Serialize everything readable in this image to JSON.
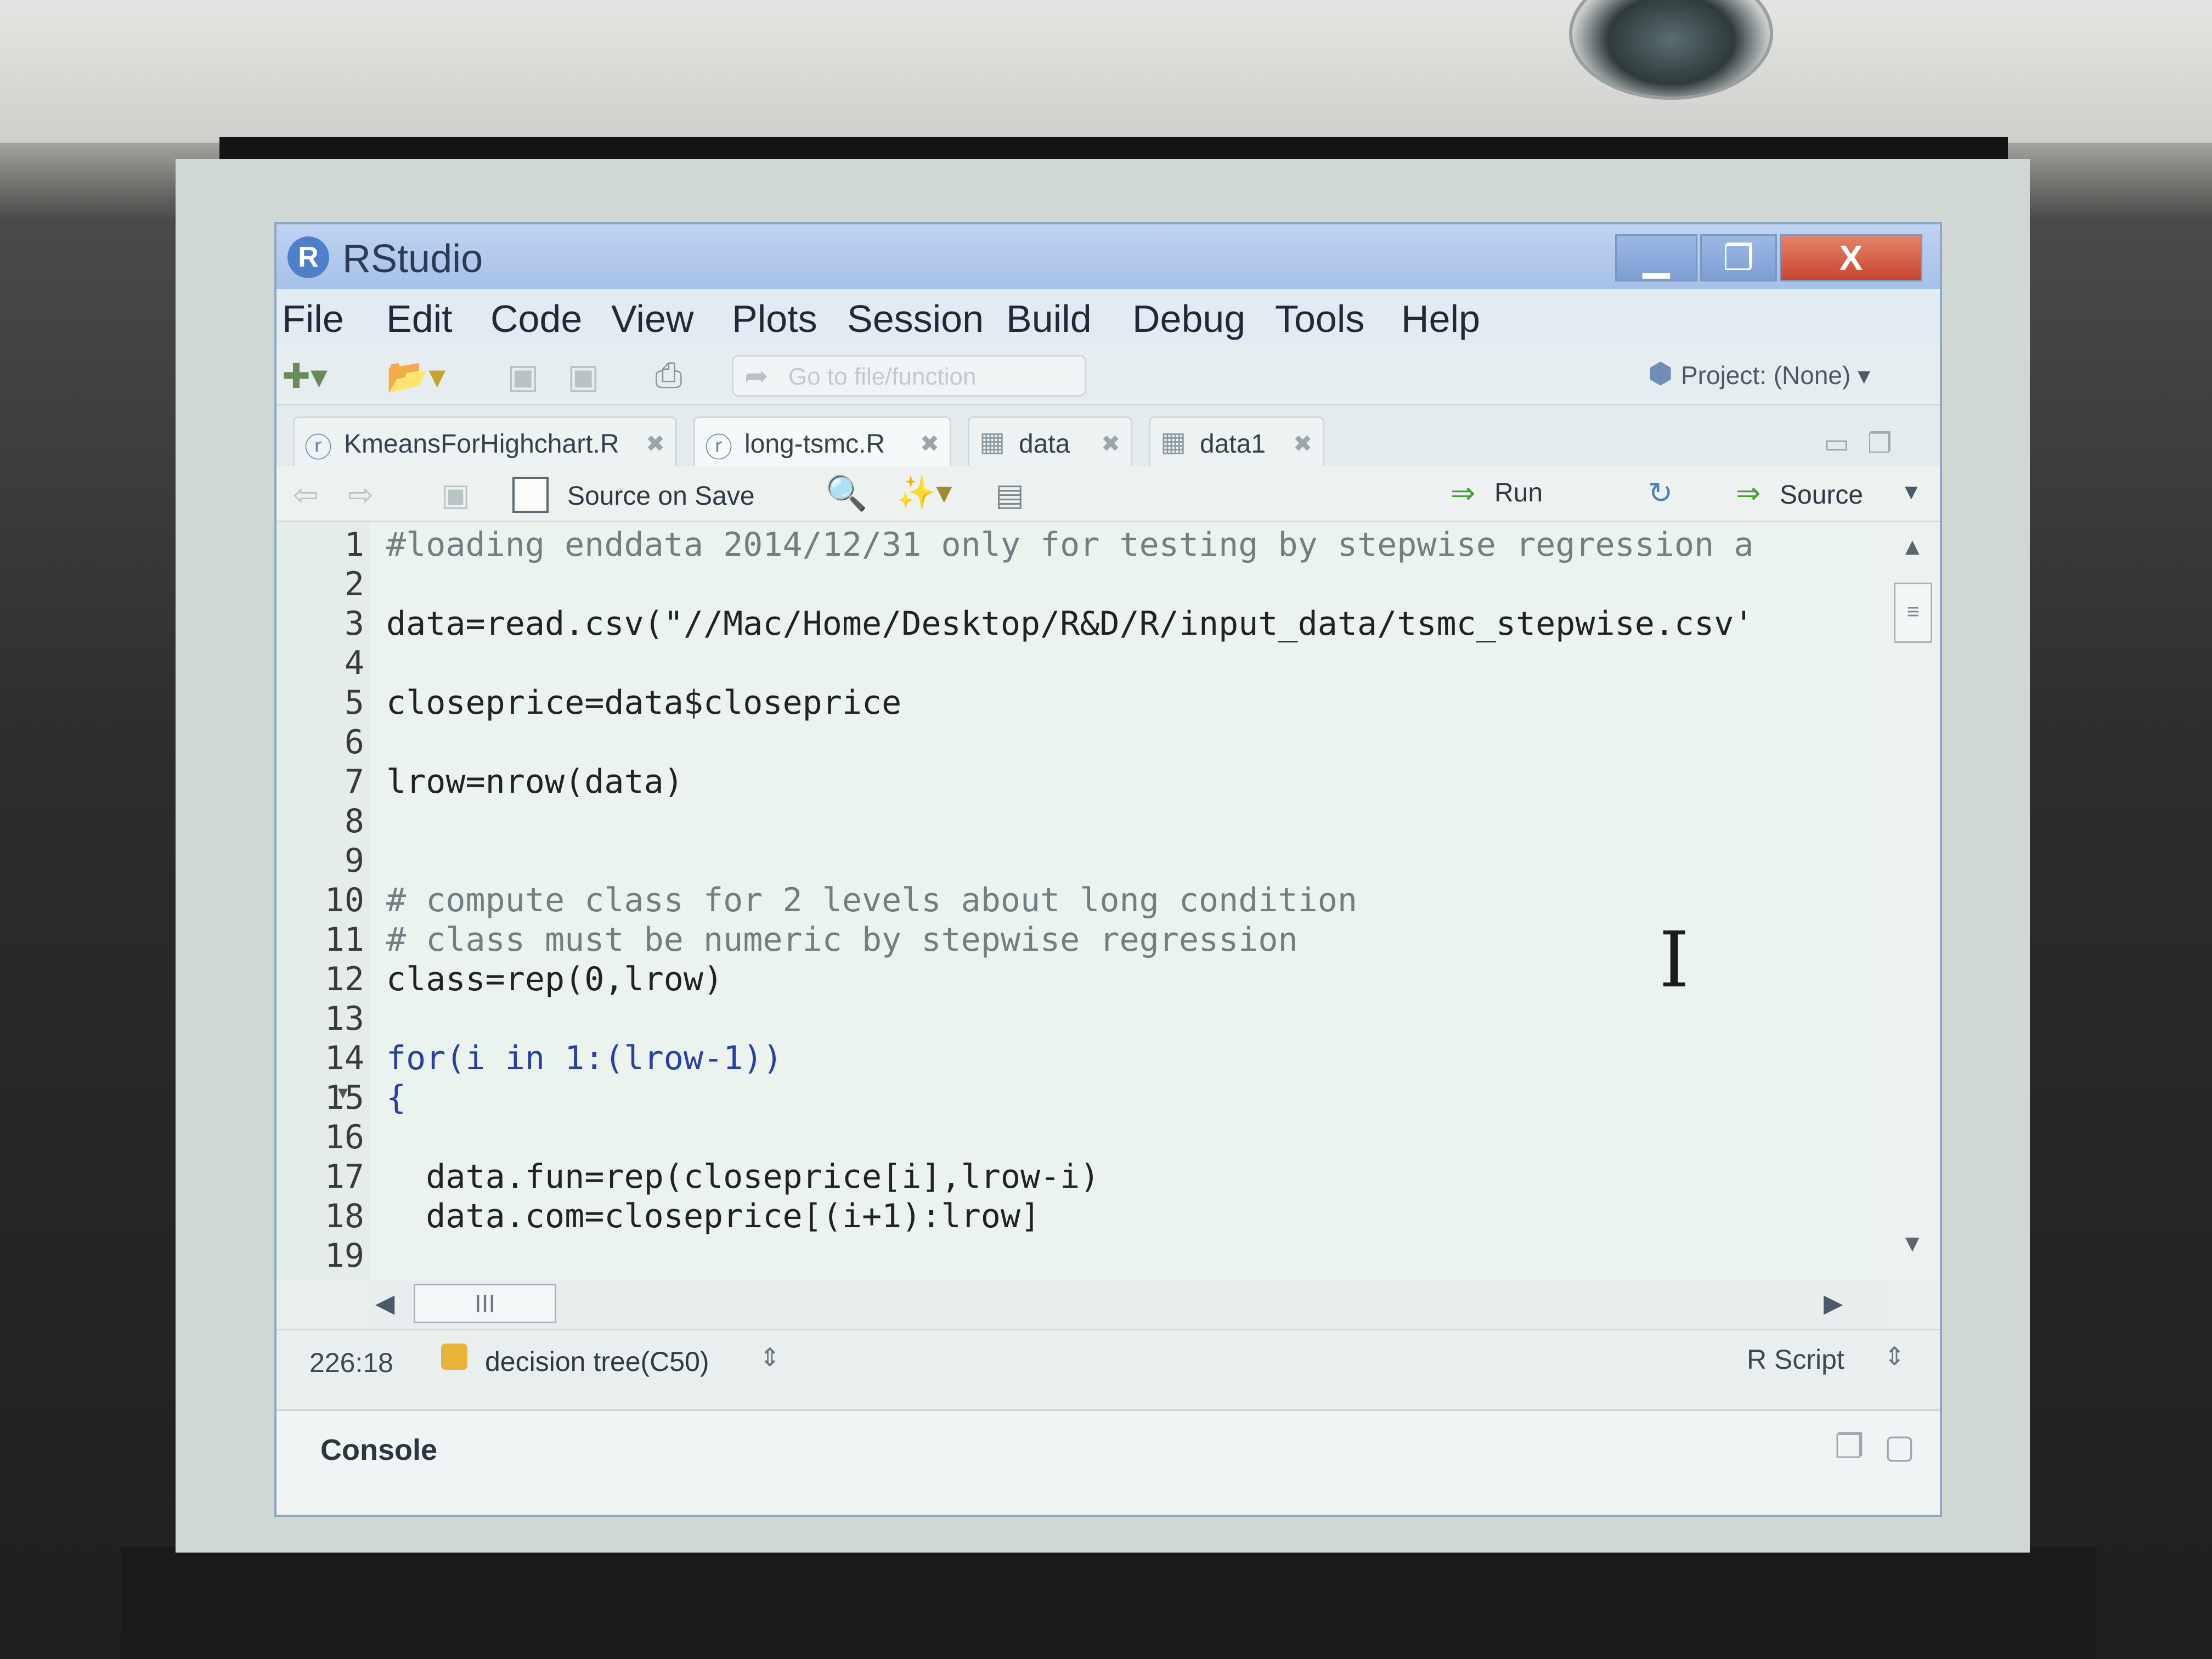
{
  "window": {
    "title": "RStudio",
    "logo_letter": "R",
    "controls": {
      "minimize": "▁",
      "maximize": "❐",
      "close": "X"
    }
  },
  "menu": [
    "File",
    "Edit",
    "Code",
    "View",
    "Plots",
    "Session",
    "Build",
    "Debug",
    "Tools",
    "Help"
  ],
  "toolbar": {
    "goto_placeholder": "Go to file/function",
    "project_label": "Project: (None) ▾"
  },
  "tabs": [
    {
      "label": "KmeansForHighchart.R",
      "active": false,
      "icon": "r-script-icon"
    },
    {
      "label": "long-tsmc.R",
      "active": true,
      "icon": "r-script-icon"
    },
    {
      "label": "data",
      "active": false,
      "icon": "table-icon"
    },
    {
      "label": "data1",
      "active": false,
      "icon": "table-icon"
    }
  ],
  "editor_toolbar": {
    "source_on_save": "Source on Save",
    "run": "Run",
    "source": "Source"
  },
  "code_lines": [
    {
      "n": "1",
      "text": "#loading enddata 2014/12/31 only for testing by stepwise regression a"
    },
    {
      "n": "2",
      "text": ""
    },
    {
      "n": "3",
      "text": "data=read.csv(\"//Mac/Home/Desktop/R&D/R/input_data/tsmc_stepwise.csv'"
    },
    {
      "n": "4",
      "text": ""
    },
    {
      "n": "5",
      "text": "closeprice=data$closeprice"
    },
    {
      "n": "6",
      "text": ""
    },
    {
      "n": "7",
      "text": "lrow=nrow(data)"
    },
    {
      "n": "8",
      "text": ""
    },
    {
      "n": "9",
      "text": ""
    },
    {
      "n": "10",
      "text": "# compute class for 2 levels about long condition"
    },
    {
      "n": "11",
      "text": "# class must be numeric by stepwise regression"
    },
    {
      "n": "12",
      "text": "class=rep(0,lrow)"
    },
    {
      "n": "13",
      "text": ""
    },
    {
      "n": "14",
      "text": "for(i in 1:(lrow-1))"
    },
    {
      "n": "15",
      "text": "{"
    },
    {
      "n": "16",
      "text": ""
    },
    {
      "n": "17",
      "text": "  data.fun=rep(closeprice[i],lrow-i)"
    },
    {
      "n": "18",
      "text": "  data.com=closeprice[(i+1):lrow]"
    },
    {
      "n": "19",
      "text": ""
    }
  ],
  "statusbar": {
    "cursor": "226:18",
    "scope": "decision tree(C50)",
    "filetype": "R Script"
  },
  "console": {
    "title": "Console"
  }
}
